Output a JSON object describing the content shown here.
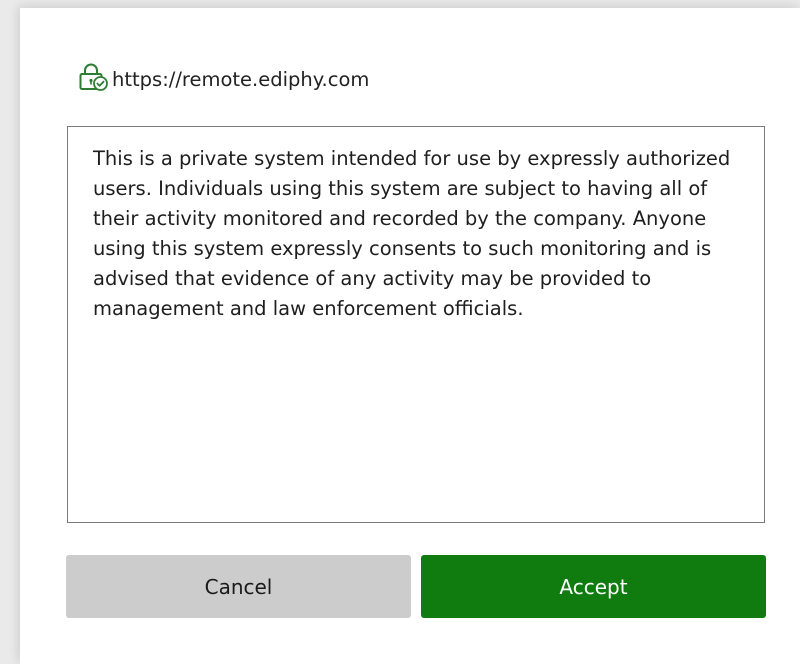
{
  "dialog": {
    "origin": {
      "icon": "lock-check-icon",
      "url": "https://remote.ediphy.com"
    },
    "notice": {
      "text": "This is a private system intended for use by expressly authorized users. Individuals using this system are subject to having all of their activity monitored and recorded by the company. Anyone using this system expressly consents to such monitoring and is advised that evidence of any activity may be provided to management and law enforcement officials."
    },
    "buttons": {
      "cancel_label": "Cancel",
      "accept_label": "Accept"
    }
  },
  "colors": {
    "accent": "#107c10",
    "cancel_bg": "#cccccc",
    "text": "#1e1e1e"
  }
}
